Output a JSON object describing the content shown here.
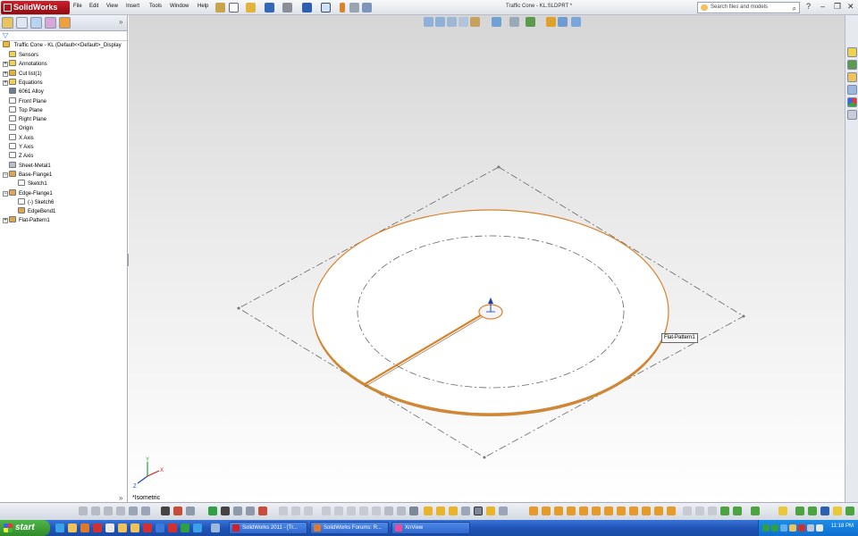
{
  "app": {
    "logo_text": "SolidWorks",
    "menu": [
      "File",
      "Edit",
      "View",
      "Insert",
      "Tools",
      "Window",
      "Help"
    ],
    "document_title": "Traffic Cone - KL.SLDPRT *",
    "search_placeholder": "Search files and models",
    "window_controls": {
      "help": "?",
      "minimize": "–",
      "restore": "❐",
      "close": "✕"
    }
  },
  "feature_tree": {
    "root": "Traffic Cone - KL  (Default<<Default>_Display",
    "items": [
      {
        "label": "Sensors",
        "icon": "sensors-icon",
        "expander": ""
      },
      {
        "label": "Annotations",
        "icon": "annotations-icon",
        "expander": "+"
      },
      {
        "label": "Cut list(1)",
        "icon": "cut-list-icon",
        "expander": "+"
      },
      {
        "label": "Equations",
        "icon": "equations-icon",
        "expander": "+"
      },
      {
        "label": "6061 Alloy",
        "icon": "material-icon",
        "expander": ""
      },
      {
        "label": "Front Plane",
        "icon": "plane-icon",
        "expander": ""
      },
      {
        "label": "Top Plane",
        "icon": "plane-icon",
        "expander": ""
      },
      {
        "label": "Right Plane",
        "icon": "plane-icon",
        "expander": ""
      },
      {
        "label": "Origin",
        "icon": "origin-icon",
        "expander": ""
      },
      {
        "label": "X Axis",
        "icon": "axis-icon",
        "expander": ""
      },
      {
        "label": "Y Axis",
        "icon": "axis-icon",
        "expander": ""
      },
      {
        "label": "Z Axis",
        "icon": "axis-icon",
        "expander": ""
      },
      {
        "label": "Sheet-Metal1",
        "icon": "sheet-metal-icon",
        "expander": ""
      },
      {
        "label": "Base-Flange1",
        "icon": "base-flange-icon",
        "expander": "−"
      },
      {
        "label": "Sketch1",
        "icon": "sketch-icon",
        "expander": "",
        "indent": 1
      },
      {
        "label": "Edge-Flange1",
        "icon": "edge-flange-icon",
        "expander": "−"
      },
      {
        "label": "(-) Sketch6",
        "icon": "sketch-icon",
        "expander": "",
        "indent": 1
      },
      {
        "label": "EdgeBend1",
        "icon": "edge-bend-icon",
        "expander": "",
        "indent": 1
      },
      {
        "label": "Flat-Pattern1",
        "icon": "flat-pattern-icon",
        "expander": "+"
      }
    ]
  },
  "viewport": {
    "view_name": "*Isometric",
    "feature_tag": "Flat-Pattern1"
  },
  "taskbar": {
    "start_label": "start",
    "tasks": [
      "SolidWorks 2011 - [Tr...",
      "SolidWorks Forums: R...",
      "XnView"
    ],
    "clock": "11:18 PM"
  },
  "colors": {
    "accent": "#d9822b",
    "sketch_line": "#666666",
    "taskbar": "#245edb"
  }
}
